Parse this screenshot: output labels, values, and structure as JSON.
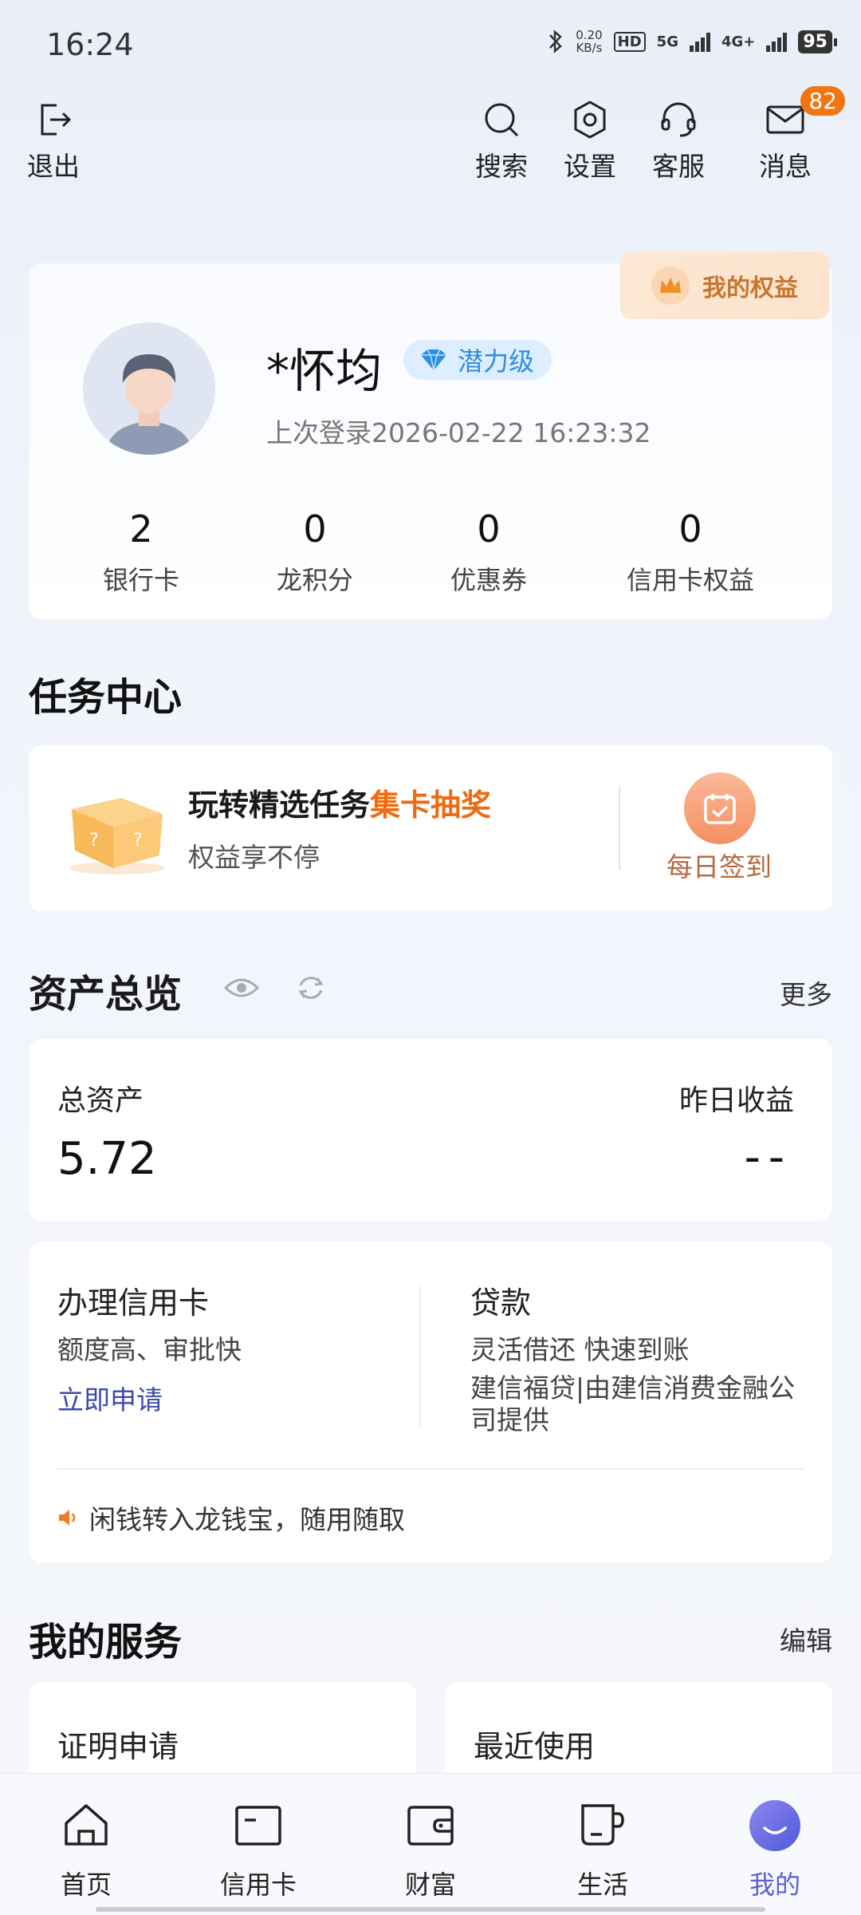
{
  "status_bar": {
    "time": "16:24",
    "net_speed_value": "0.20",
    "net_speed_unit": "KB/s",
    "hd_label": "HD",
    "sim1_label": "5G",
    "sim2_label": "4G+",
    "battery": "95"
  },
  "top_nav": {
    "logout": "退出",
    "search": "搜索",
    "settings": "设置",
    "service": "客服",
    "messages": "消息",
    "message_count": "82"
  },
  "profile": {
    "rights": "我的权益",
    "name": "*怀均",
    "level": "潜力级",
    "last_login": "上次登录2026-02-22 16:23:32",
    "stats": [
      {
        "value": "2",
        "label": "银行卡"
      },
      {
        "value": "0",
        "label": "龙积分"
      },
      {
        "value": "0",
        "label": "优惠券"
      },
      {
        "value": "0",
        "label": "信用卡权益"
      }
    ]
  },
  "task_center": {
    "title": "任务中心",
    "main_text": "玩转精选任务",
    "highlight": "集卡抽奖",
    "sub_text": "权益享不停",
    "checkin": "每日签到"
  },
  "assets": {
    "title": "资产总览",
    "more": "更多",
    "total_label": "总资产",
    "total_value": "5.72",
    "yield_label": "昨日收益",
    "yield_value": "--"
  },
  "products": {
    "credit_title": "办理信用卡",
    "credit_desc": "额度高、审批快",
    "credit_link": "立即申请",
    "loan_title": "贷款",
    "loan_desc1": "灵活借还 快速到账",
    "loan_desc2": "建信福贷|由建信消费金融公司提供",
    "tip": "闲钱转入龙钱宝，随用随取"
  },
  "services": {
    "title": "我的服务",
    "edit": "编辑",
    "cards": [
      "证明申请",
      "最近使用"
    ]
  },
  "tabs": [
    {
      "label": "首页",
      "icon": "home-icon"
    },
    {
      "label": "信用卡",
      "icon": "credit-card-icon"
    },
    {
      "label": "财富",
      "icon": "wallet-icon"
    },
    {
      "label": "生活",
      "icon": "cup-icon"
    },
    {
      "label": "我的",
      "icon": "profile-icon"
    }
  ],
  "colors": {
    "accent_orange": "#ef6a10",
    "active_tab": "#5b5fd8",
    "link_blue": "#3a4aa8",
    "badge": "#f2750f"
  }
}
